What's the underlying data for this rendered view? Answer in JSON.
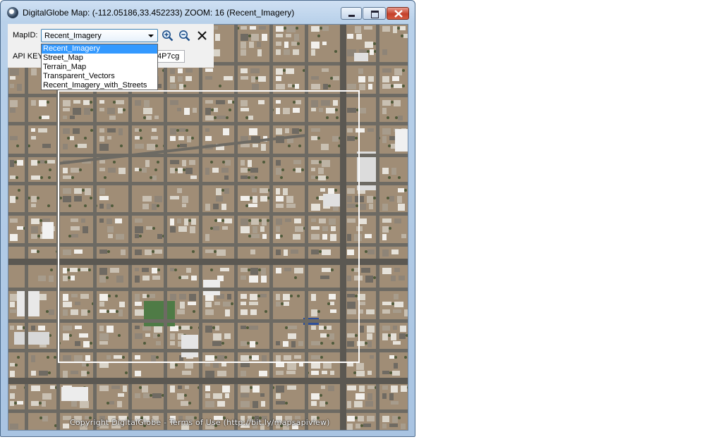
{
  "window": {
    "title": "DigitalGlobe Map: (-112.05186,33.452233) ZOOM: 16 (Recent_Imagery)",
    "controls": {
      "minimize": "minimize-icon",
      "maximize": "maximize-icon",
      "close": "close-icon"
    }
  },
  "panel": {
    "mapid_label": "MapID:",
    "mapid_value": "Recent_Imagery",
    "apikey_label": "API KEY",
    "apikey_value": "4P7cg",
    "zoom_in_icon": "zoom-in-icon",
    "zoom_out_icon": "zoom-out-icon",
    "close_icon": "close-icon"
  },
  "dropdown": {
    "options": [
      "Recent_Imagery",
      "Street_Map",
      "Terrain_Map",
      "Transparent_Vectors",
      "Recent_Imagery_with_Streets"
    ],
    "selected": 0
  },
  "map": {
    "copyright": "Copyright DigitalGlobe - Terms of Use (http://bit.ly/mapsapiview)",
    "selection_border_color": "#ffffff",
    "ground_color": "#a08d76",
    "road_color": "#6d6a63"
  }
}
